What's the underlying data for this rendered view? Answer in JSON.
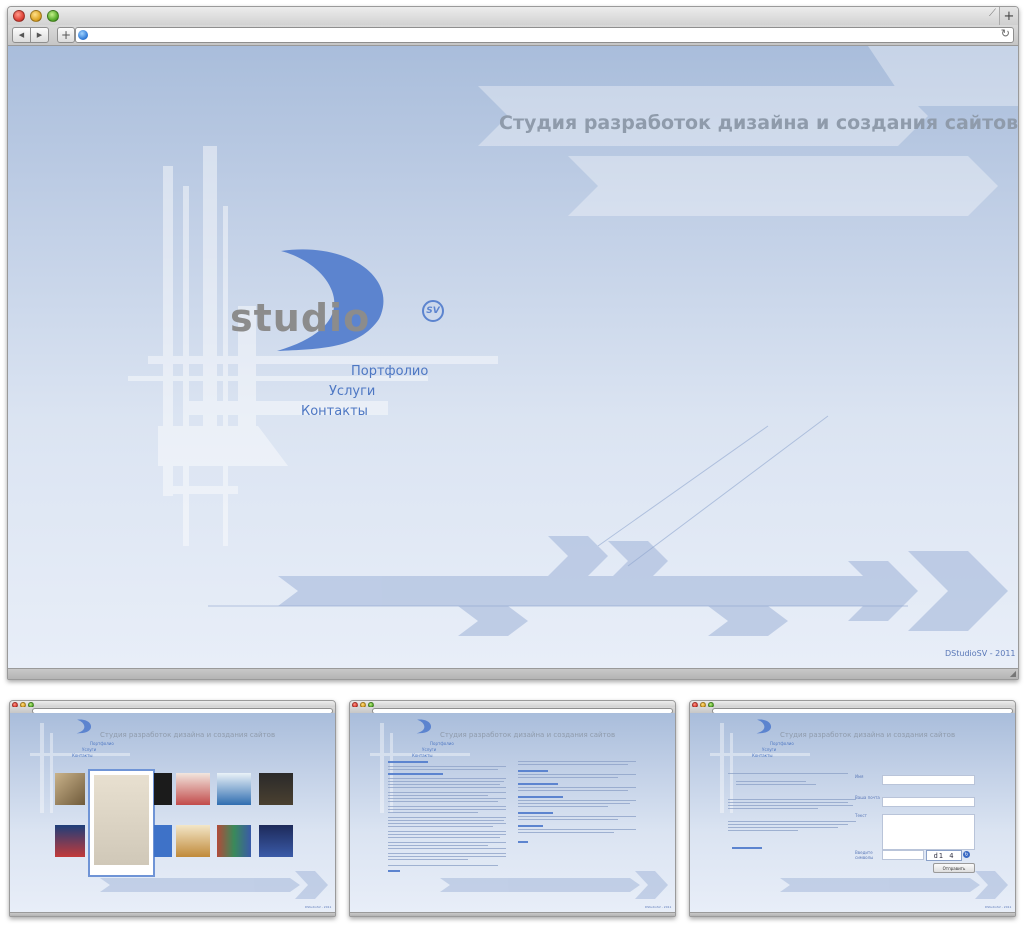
{
  "main": {
    "window_title": "",
    "url": "",
    "site_title": "Студия разработок дизайна и создания сайтов",
    "nav": [
      "Портфолио",
      "Услуги",
      "Контакты"
    ],
    "logo_text": "studio",
    "logo_badge": "SV",
    "footer": "DStudioSV - 2011"
  },
  "preview_portfolio": {
    "site_title": "Студия разработок дизайна и создания сайтов",
    "nav": [
      "Портфолио",
      "Услуги",
      "Контакты"
    ],
    "footer": "DStudioSV - 2011"
  },
  "preview_services": {
    "site_title": "Студия разработок дизайна и создания сайтов",
    "nav": [
      "Портфолио",
      "Услуги",
      "Контакты"
    ],
    "footer": "DStudioSV - 2011"
  },
  "preview_contacts": {
    "site_title": "Студия разработок дизайна и создания сайтов",
    "nav": [
      "Портфолио",
      "Услуги",
      "Контакты"
    ],
    "labels": [
      "Имя",
      "Ваша почта",
      "Текст",
      "Введите символы"
    ],
    "captcha": "d1 4",
    "send_label": "Отправить",
    "footer": "DStudioSV - 2011"
  },
  "colors": {
    "accent": "#4d77c3",
    "logo_blue": "#5c84cf",
    "logo_gray": "#8c8c8c",
    "title_gray": "#8f9bab",
    "bg_top": "#a9bddb",
    "bg_bottom": "#e8eef8"
  },
  "icons": {
    "traffic_lights": [
      "close-icon",
      "minimize-icon",
      "zoom-icon"
    ],
    "back": "back-arrow-icon",
    "forward": "forward-arrow-icon",
    "add": "plus-icon",
    "site": "globe-icon",
    "reload": "reload-icon",
    "new_tab": "plus-icon",
    "overflow": "overflow-icon"
  }
}
